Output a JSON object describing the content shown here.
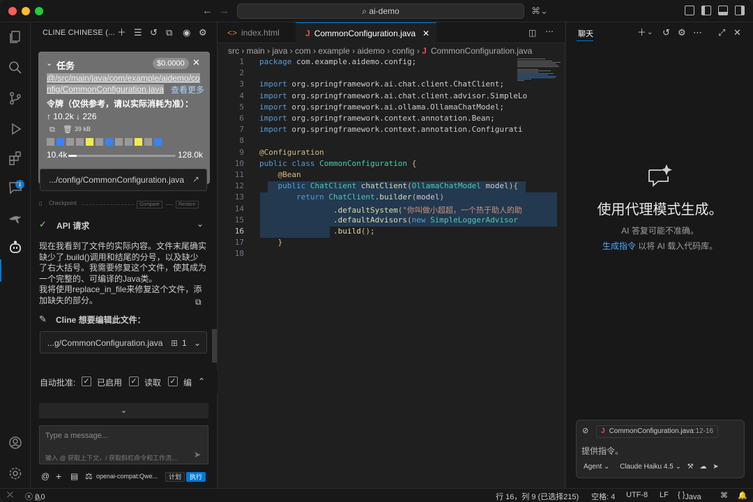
{
  "titlebar": {
    "search": "ai-demo"
  },
  "cline": {
    "title": "CLINE CHINESE (...",
    "task": {
      "label": "任务",
      "cost": "$0.0000",
      "path_line1": "@/src/main/java/com/example/aidemo/co",
      "path_line2": "nfig/CommonConfiguration.java",
      "see_more": "查看更多",
      "tokens_title": "令牌（仅供参考，请以实际消耗为准）：",
      "tokens_up": "↑ 10.2k",
      "tokens_down": "↓ 226",
      "size": "39 kB",
      "context_used": "10.4k",
      "context_max": "128.0k",
      "context_fraction": 0.08,
      "cells": [
        "#9a9a9a",
        "#3b82f6",
        "#9a9a9a",
        "#9a9a9a",
        "#f5e94b",
        "#9a9a9a",
        "#3b82f6",
        "#9a9a9a",
        "#9a9a9a",
        "#f5e94b",
        "#9a9a9a",
        "#3b82f6"
      ]
    },
    "file_ref": ".../config/CommonConfiguration.java",
    "checkpoint": {
      "label": "Checkpoint",
      "compare": "Compare",
      "restore": "Restore"
    },
    "api_request": "API 请求",
    "message": "现在我看到了文件的实际内容。文件末尾确实缺少了.build()调用和结尾的分号，以及缺少了右大括号。我需要修复这个文件，使其成为一个完整的、可编译的Java类。\n我将使用replace_in_file来修复这个文件，添加缺失的部分。",
    "edit_title": "Cline 想要编辑此文件：",
    "edit_file": "...g/CommonConfiguration.java",
    "edit_count": "1",
    "auto_approve": {
      "label": "自动批准:",
      "enabled": "已启用",
      "read": "读取",
      "edit": "编"
    },
    "input": {
      "placeholder": "Type a message...",
      "hint": "输入 @ 获取上下文，/ 获取斜杠命令和工作流..."
    },
    "model": "openai-compat:Qwe...",
    "plan": "计划",
    "act": "执行"
  },
  "editor": {
    "tabs": [
      {
        "label": "index.html"
      },
      {
        "label": "CommonConfiguration.java"
      }
    ],
    "breadcrumb": [
      "src",
      "main",
      "java",
      "com",
      "example",
      "aidemo",
      "config",
      "CommonConfiguration.java"
    ],
    "current_line": 16
  },
  "chat": {
    "title": "聊天",
    "heading": "使用代理模式生成。",
    "subtitle": "AI 答复可能不准确。",
    "link": "生成指令",
    "link_suffix": " 以将 AI 载入代码库。",
    "attachment": "CommonConfiguration.java",
    "attachment_range": ":12-16",
    "placeholder": "提供指令。",
    "agent": "Agent",
    "model": "Claude Haiku 4.5"
  },
  "status": {
    "errors": "0",
    "warnings": "0",
    "position": "行 16，列 9 (已选择215)",
    "spaces": "空格: 4",
    "encoding": "UTF-8",
    "eol": "LF",
    "language": "Java"
  }
}
